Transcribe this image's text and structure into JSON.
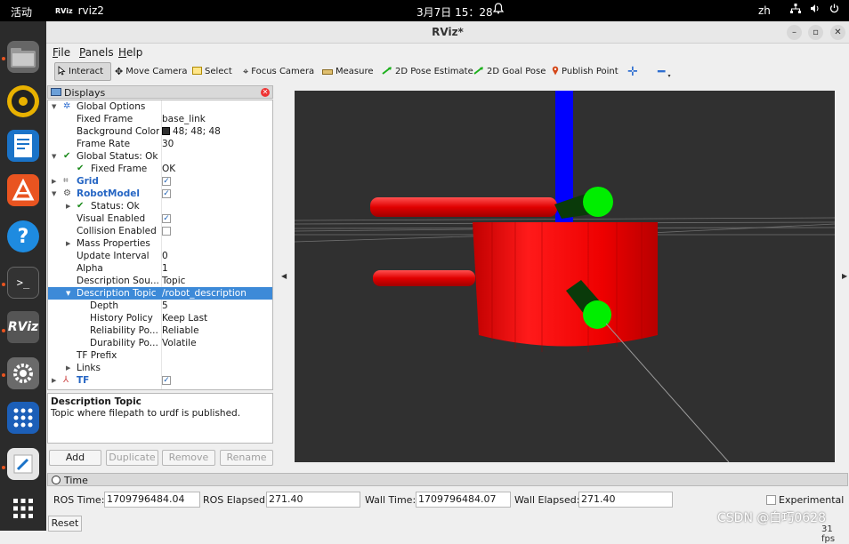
{
  "topbar": {
    "activities": "活动",
    "app_name": "rviz2",
    "app_badge": "RViz",
    "clock": "3月7日 15：28",
    "lang": "zh"
  },
  "window": {
    "title": "RViz*"
  },
  "menu": {
    "file": "File",
    "panels": "Panels",
    "help": "Help"
  },
  "toolbar": {
    "interact": "Interact",
    "move_camera": "Move Camera",
    "select": "Select",
    "focus_camera": "Focus Camera",
    "measure": "Measure",
    "pose_estimate": "2D Pose Estimate",
    "goal_pose": "2D Goal Pose",
    "publish_point": "Publish Point"
  },
  "displays_panel": {
    "title": "Displays",
    "rows": [
      {
        "name": "Global Options",
        "value": ""
      },
      {
        "name": "Fixed Frame",
        "value": "base_link"
      },
      {
        "name": "Background Color",
        "value": "48; 48; 48"
      },
      {
        "name": "Frame Rate",
        "value": "30"
      },
      {
        "name": "Global Status: Ok",
        "value": ""
      },
      {
        "name": "Fixed Frame",
        "value": "OK"
      },
      {
        "name": "Grid",
        "value": ""
      },
      {
        "name": "RobotModel",
        "value": ""
      },
      {
        "name": "Status: Ok",
        "value": ""
      },
      {
        "name": "Visual Enabled",
        "value": ""
      },
      {
        "name": "Collision Enabled",
        "value": ""
      },
      {
        "name": "Mass Properties",
        "value": ""
      },
      {
        "name": "Update Interval",
        "value": "0"
      },
      {
        "name": "Alpha",
        "value": "1"
      },
      {
        "name": "Description Sou...",
        "value": "Topic"
      },
      {
        "name": "Description Topic",
        "value": "/robot_description"
      },
      {
        "name": "Depth",
        "value": "5"
      },
      {
        "name": "History Policy",
        "value": "Keep Last"
      },
      {
        "name": "Reliability Po...",
        "value": "Reliable"
      },
      {
        "name": "Durability Po...",
        "value": "Volatile"
      },
      {
        "name": "TF Prefix",
        "value": ""
      },
      {
        "name": "Links",
        "value": ""
      },
      {
        "name": "TF",
        "value": ""
      }
    ],
    "checks": {
      "grid": true,
      "robotmodel": true,
      "visual_enabled": true,
      "collision_enabled": false,
      "tf": true
    },
    "background_color": "#303030",
    "description_title": "Description Topic",
    "description_text": "Topic where filepath to urdf is published.",
    "buttons": {
      "add": "Add",
      "duplicate": "Duplicate",
      "remove": "Remove",
      "rename": "Rename"
    }
  },
  "time_panel": {
    "title": "Time",
    "ros_time_label": "ROS Time:",
    "ros_time": "1709796484.04",
    "ros_elapsed_label": "ROS Elapsed:",
    "ros_elapsed": "271.40",
    "wall_time_label": "Wall Time:",
    "wall_time": "1709796484.07",
    "wall_elapsed_label": "Wall Elapsed:",
    "wall_elapsed": "271.40",
    "experimental_label": "Experimental",
    "reset": "Reset",
    "fps": "31 fps"
  },
  "watermark": "CSDN @白巧0628",
  "colors": {
    "accent": "#3d8ad8",
    "robot_red": "#ff0000",
    "axis_blue": "#0000ff",
    "joint_green": "#00ee00"
  }
}
